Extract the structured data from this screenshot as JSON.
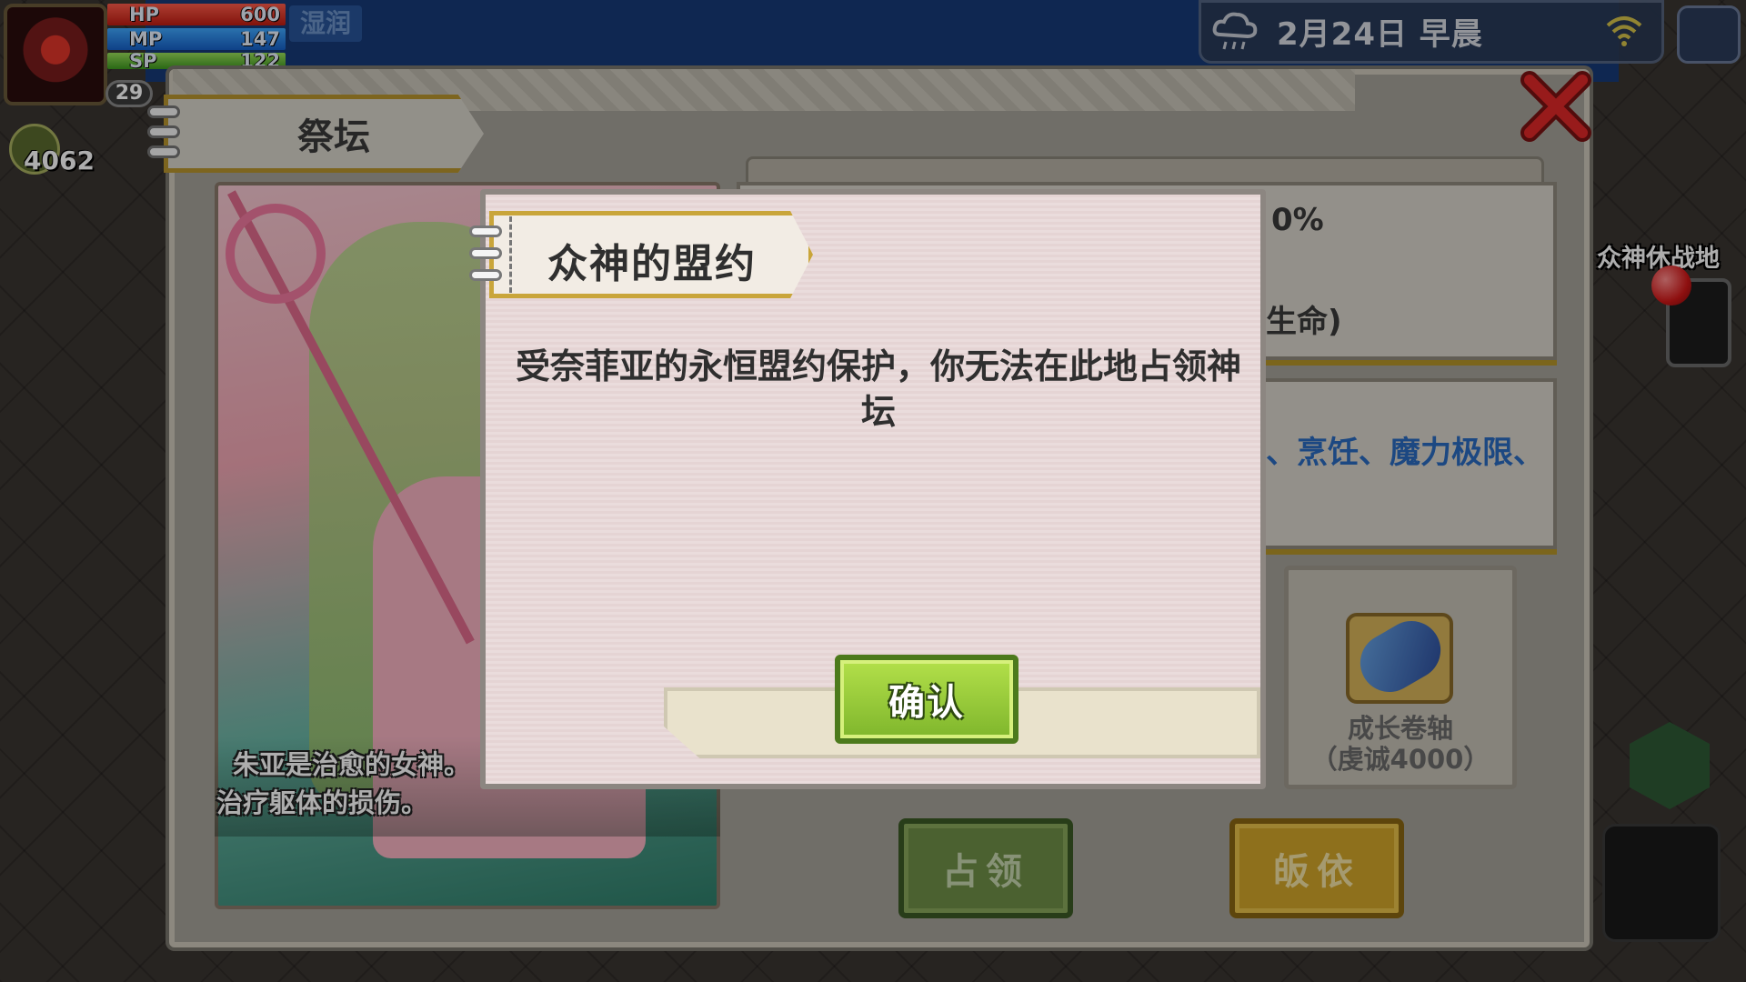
{
  "hud": {
    "hp_label": "HP",
    "hp_value": "600",
    "mp_label": "MP",
    "mp_value": "147",
    "sp_label": "SP",
    "sp_value": "122",
    "level": "29",
    "weather": "湿润",
    "currency": "4062",
    "date": "2月24日 早晨",
    "weather_icon": "rain-cloud-icon",
    "signal_icon": "wifi-icon",
    "exit_icon": "exit-icon"
  },
  "map": {
    "location_label": "众神休战地"
  },
  "altar": {
    "title": "祭坛",
    "character_desc_line1": "朱亚是治愈的女神。",
    "character_desc_line2": "治疗躯体的损伤。",
    "info_percent": "0%",
    "info_life": "生命)",
    "info_skills": "、烹饪、魔力极限、",
    "reward_name": "成长卷轴",
    "reward_cost": "（虔诚4000）",
    "occupy_label": "占领",
    "convert_label": "皈依"
  },
  "modal": {
    "title": "众神的盟约",
    "message": "受奈菲亚的永恒盟约保护，你无法在此地占领神坛",
    "confirm_label": "确认"
  },
  "colors": {
    "confirm_green": "#8cc63a",
    "occupy_green": "#6f8f47",
    "convert_gold": "#d1a52a",
    "skills_blue": "#2a6ac0",
    "close_red": "#e02828"
  }
}
